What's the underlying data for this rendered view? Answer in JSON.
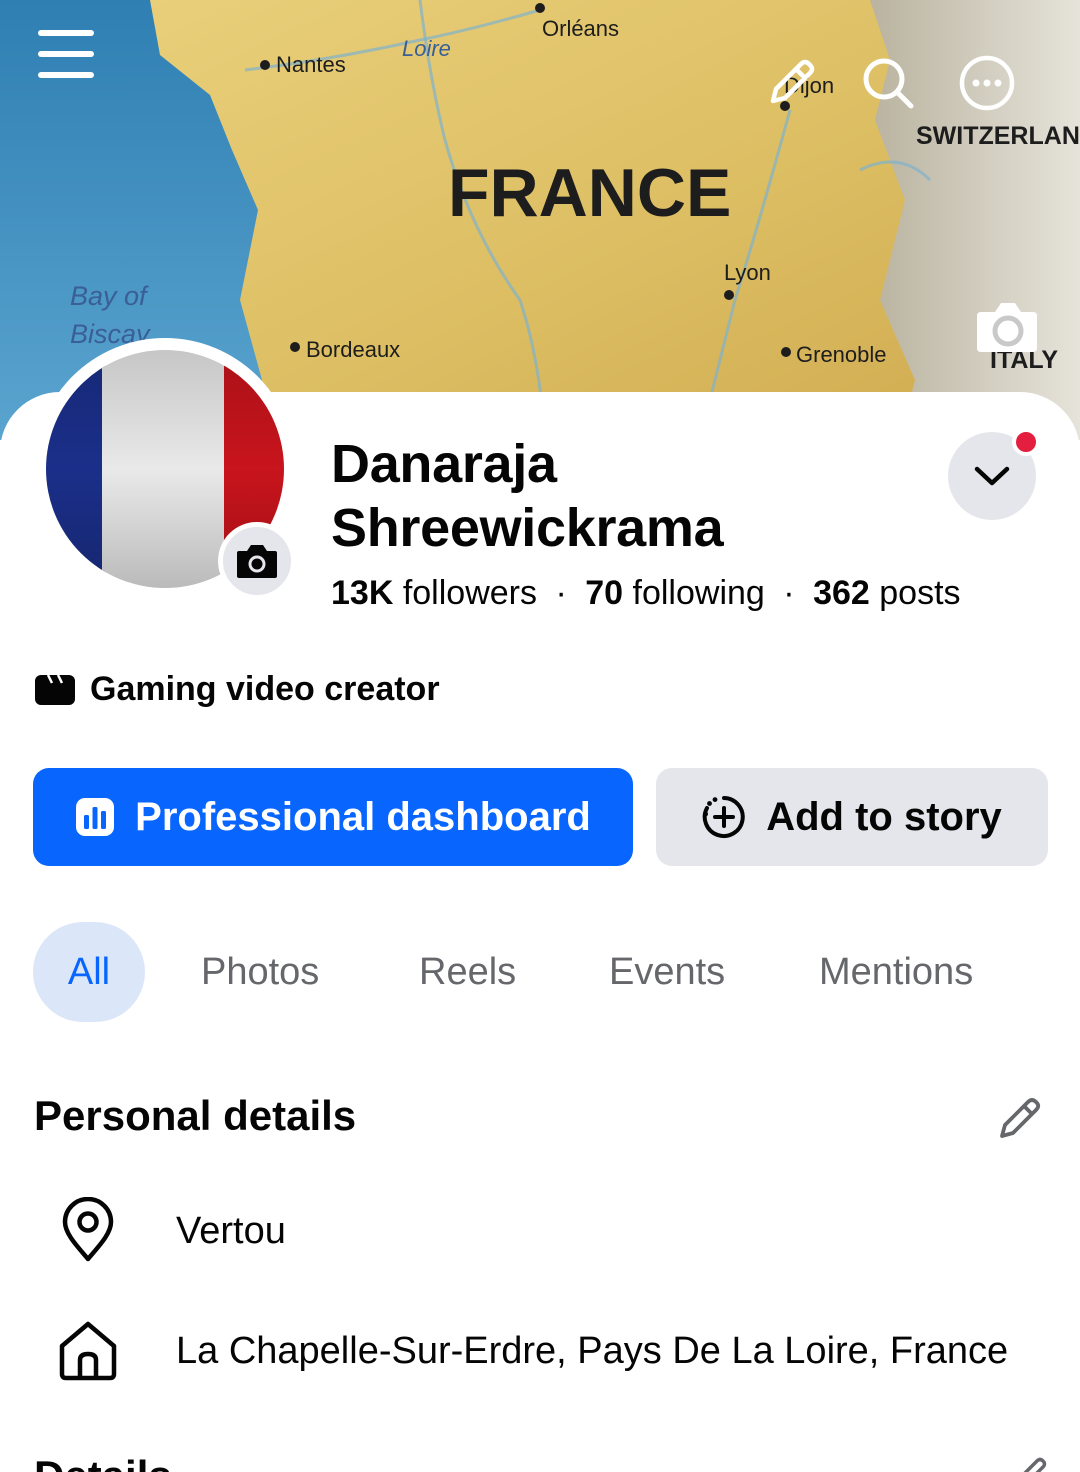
{
  "cover": {
    "map_labels": {
      "country": "FRANCE",
      "neighbor_1": "SWITZERLAND",
      "neighbor_2": "ITALY",
      "sea_line_1": "Bay of",
      "sea_line_2": "Biscay",
      "river": "Loire",
      "cities": [
        "Orléans",
        "Nantes",
        "Dijon",
        "Lyon",
        "Bordeaux",
        "Grenoble"
      ]
    },
    "icons": [
      "menu-icon",
      "pencil-icon",
      "search-icon",
      "more-icon",
      "camera-icon"
    ]
  },
  "profile": {
    "name": "Danaraja Shreewickrama",
    "followers_count": "13K",
    "followers_label": "followers",
    "following_count": "70",
    "following_label": "following",
    "posts_count": "362",
    "posts_label": "posts",
    "separator": "·",
    "category": "Gaming video creator",
    "has_notification": true
  },
  "actions": {
    "primary_label": "Professional dashboard",
    "secondary_label": "Add to story"
  },
  "tabs": [
    {
      "label": "All",
      "active": true
    },
    {
      "label": "Photos",
      "active": false
    },
    {
      "label": "Reels",
      "active": false
    },
    {
      "label": "Events",
      "active": false
    },
    {
      "label": "Mentions",
      "active": false
    }
  ],
  "personal_details": {
    "title": "Personal details",
    "current_city": "Vertou",
    "hometown": "La Chapelle-Sur-Erdre, Pays De La Loire, France"
  },
  "next_section": {
    "title_partial": "Details"
  },
  "colors": {
    "accent": "#0866ff",
    "active_tab_bg": "#dbe7f8",
    "secondary_button_bg": "#e4e6eb",
    "notification": "#e41e3f",
    "muted_text": "#65676b"
  }
}
